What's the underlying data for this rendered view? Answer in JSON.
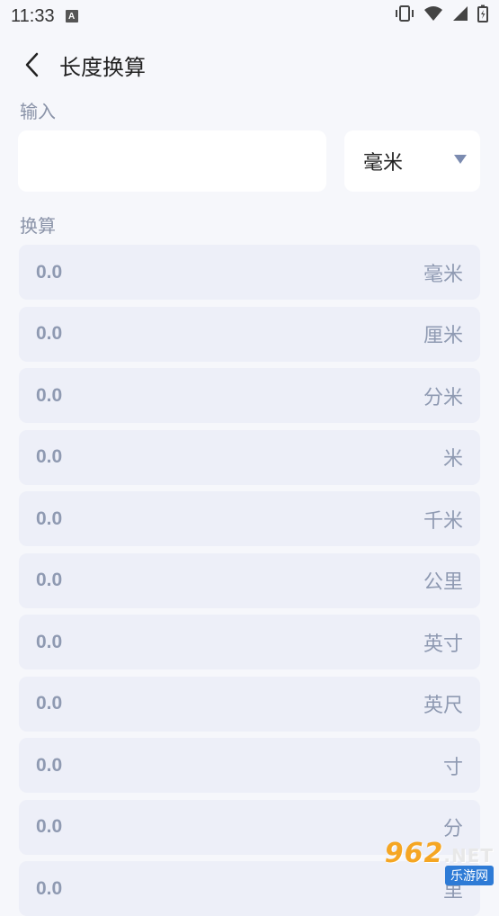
{
  "status_bar": {
    "time": "11:33",
    "notification_icon": "A",
    "icons": [
      "vibrate-icon",
      "wifi-icon",
      "signal-icon",
      "battery-icon"
    ]
  },
  "header": {
    "title": "长度换算",
    "back_icon": "chevron-left-icon"
  },
  "input_section": {
    "label": "输入",
    "value": "",
    "placeholder": "",
    "unit_selected": "毫米",
    "caret_icon": "triangle-down-icon"
  },
  "results_section": {
    "label": "换算",
    "rows": [
      {
        "value": "0.0",
        "unit": "毫米"
      },
      {
        "value": "0.0",
        "unit": "厘米"
      },
      {
        "value": "0.0",
        "unit": "分米"
      },
      {
        "value": "0.0",
        "unit": "米"
      },
      {
        "value": "0.0",
        "unit": "千米"
      },
      {
        "value": "0.0",
        "unit": "公里"
      },
      {
        "value": "0.0",
        "unit": "英寸"
      },
      {
        "value": "0.0",
        "unit": "英尺"
      },
      {
        "value": "0.0",
        "unit": "寸"
      },
      {
        "value": "0.0",
        "unit": "分"
      },
      {
        "value": "0.0",
        "unit": "里"
      }
    ]
  },
  "watermark": {
    "brand": "962",
    "suffix": ".NET",
    "subtitle": "乐游网"
  },
  "colors": {
    "background": "#f6f7fb",
    "row_background": "#edeff8",
    "muted_text": "#8f9ab2",
    "label_text": "#8a93a8",
    "caret": "#7b8bb0"
  }
}
